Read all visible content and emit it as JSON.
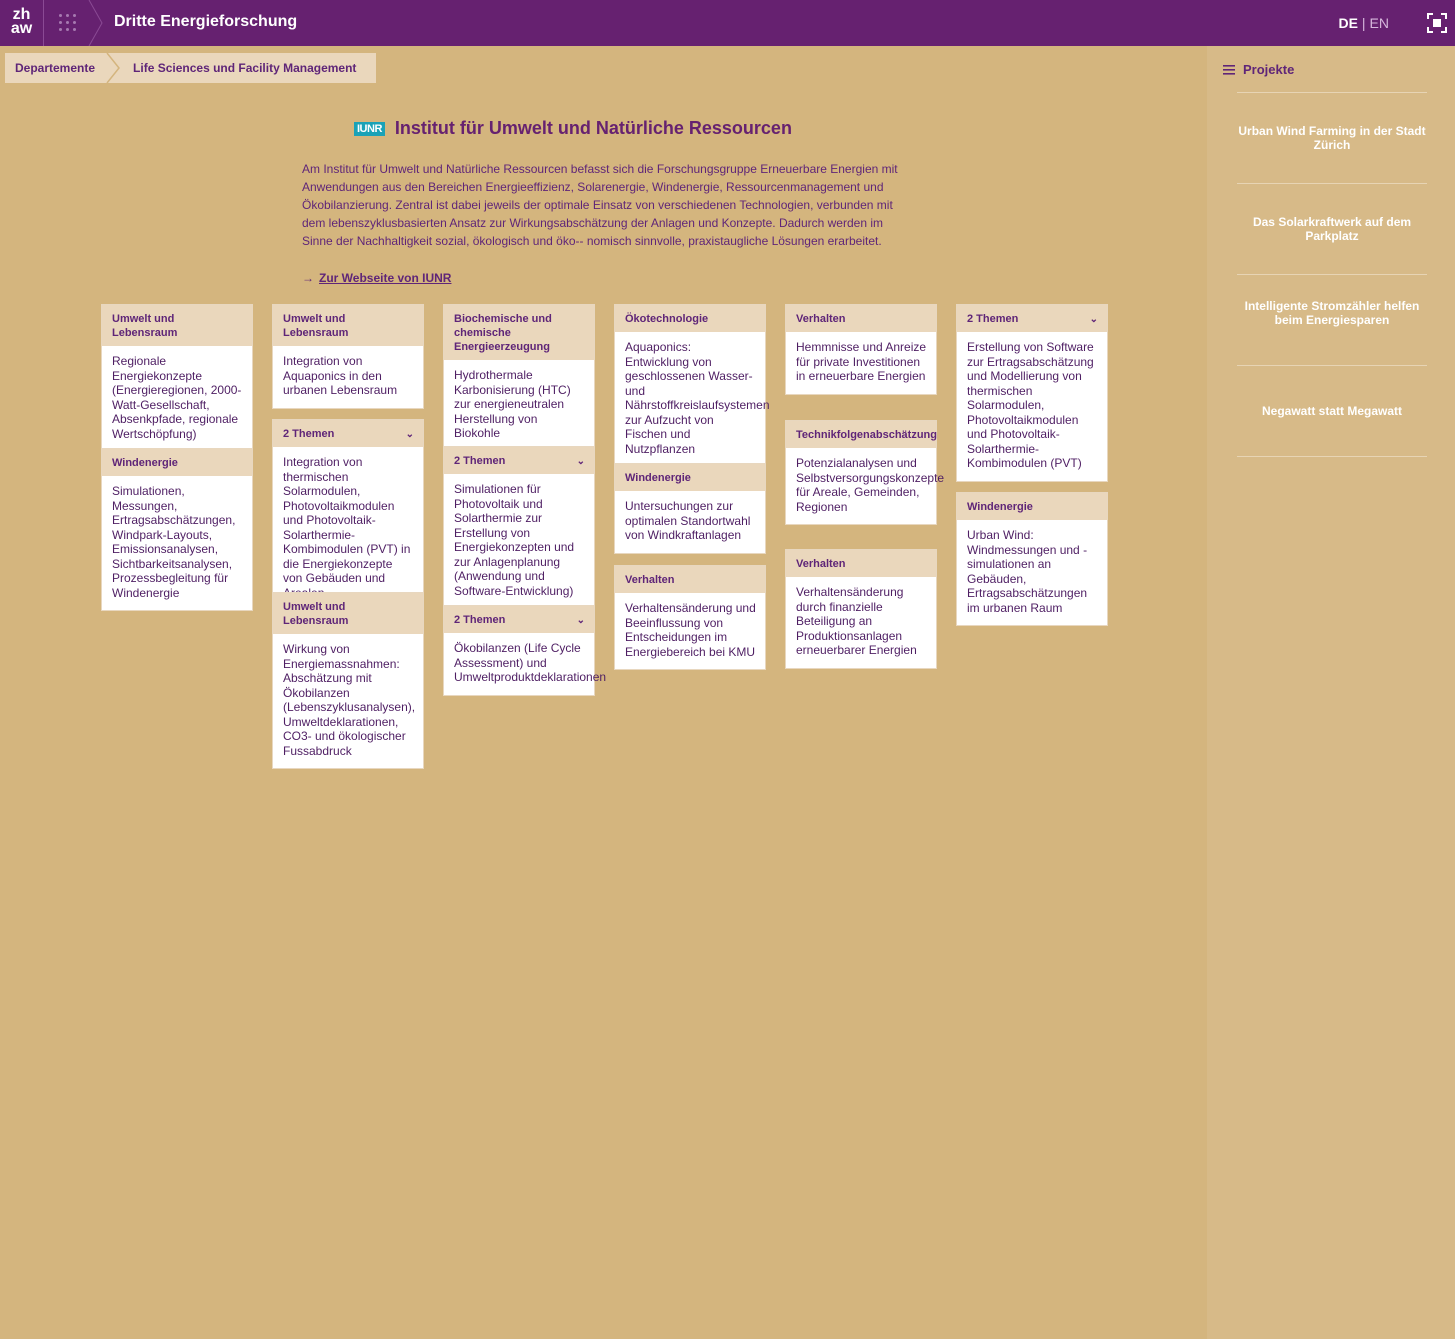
{
  "topbar": {
    "logo_line1": "zh",
    "logo_line2": "aw",
    "title": "Dritte Energieforschung",
    "lang_de": "DE",
    "lang_sep": "|",
    "lang_en": "EN"
  },
  "breadcrumb": {
    "items": [
      "Departemente",
      "Life Sciences und Facility Management"
    ]
  },
  "institute": {
    "badge": "IUNR",
    "title": "Institut für Umwelt und Natürliche Ressourcen",
    "description": "Am Institut für Umwelt und Natürliche Ressourcen befasst sich die Forschungsgruppe Erneuerbare Energien mit Anwendungen aus den Bereichen Energieeffizienz, Solarenergie, Windenergie, Ressourcenmanagement und Ökobilanzierung. Zentral ist dabei jeweils der optimale Einsatz von verschiedenen Technologien, verbunden mit dem lebenszyklusbasierten Ansatz zur Wirkungsabschätzung der Anlagen und Konzepte. Dadurch werden im Sinne der Nachhaltigkeit sozial, ökologisch und öko-- nomisch sinnvolle, praxistaugliche Lösungen erarbeitet.",
    "link_arrow": "→",
    "link": "Zur Webseite von IUNR"
  },
  "cards": [
    {
      "head": "Umwelt und Lebensraum",
      "body": "Regionale Energiekonzepte (Energieregionen, 2000-Watt-Gesellschaft, Absenkpfade, regionale Wertschöpfung)"
    },
    {
      "head": "Windenergie",
      "body": "Simulationen, Messungen, Ertragsabschätzungen, Windpark-Layouts, Emissionsanalysen, Sichtbarkeitsanalysen, Prozessbegleitung für Windenergie"
    },
    {
      "head": "Umwelt und Lebensraum",
      "body": "Integration von Aquaponics in den urbanen Lebensraum"
    },
    {
      "head": "2 Themen",
      "body": "Integration von thermischen Solarmodulen, Photovoltaikmodulen und Photovoltaik-Solarthermie-Kombimodulen (PVT) in die Energiekonzepte von Gebäuden und Arealen"
    },
    {
      "head": "Umwelt und Lebensraum",
      "body": "Wirkung von Energiemassnahmen: Abschätzung mit Ökobilanzen (Lebenszyklusanalysen), Umweltdeklarationen, CO3- und ökologischer Fussabdruck"
    },
    {
      "head": "Biochemische und chemische Energieerzeugung",
      "body": "Hydrothermale Karbonisierung (HTC) zur energieneutralen Herstellung von Biokohle"
    },
    {
      "head": "2 Themen",
      "body": "Simulationen für Photovoltaik und Solarthermie zur Erstellung von Energiekonzepten und zur Anlagenplanung (Anwendung und Software-Entwicklung)"
    },
    {
      "head": "2 Themen",
      "body": "Ökobilanzen (Life Cycle Assessment) und Umweltproduktdeklarationen"
    },
    {
      "head": "Ökotechnologie",
      "body": "Aquaponics: Entwicklung von geschlossenen Wasser- und Nährstoffkreislaufsystemen zur Aufzucht von Fischen und Nutzpflanzen"
    },
    {
      "head": "Windenergie",
      "body": "Untersuchungen zur optimalen Standortwahl von Windkraftanlagen"
    },
    {
      "head": "Verhalten",
      "body": "Verhaltensänderung und Beeinflussung von Entscheidungen im Energiebereich bei KMU"
    },
    {
      "head": "Verhalten",
      "body": "Hemmnisse und Anreize für private Investitionen in erneuerbare Energien"
    },
    {
      "head": "Technikfolgenabschätzung",
      "body": "Potenzialanalysen und Selbstversorgungskonzepte für Areale, Gemeinden, Regionen"
    },
    {
      "head": "Verhalten",
      "body": "Verhaltensänderung durch finanzielle Beteiligung an Produktionsanlagen erneuerbarer Energien"
    },
    {
      "head": "2 Themen",
      "body": "Erstellung von Software zur Ertragsabschätzung und Modellierung von thermischen Solarmodulen, Photovoltaikmodulen und Photovoltaik-Solarthermie-Kombimodulen (PVT)"
    },
    {
      "head": "Windenergie",
      "body": "Urban Wind: Windmessungen und -simulationen an Gebäuden, Ertragsabschätzungen im urbanen Raum"
    }
  ],
  "sidebar": {
    "title": "Projekte",
    "items": [
      "Urban Wind Farming in der Stadt Zürich",
      "Das Solarkraftwerk auf dem Parkplatz",
      "Intelligente Stromzähler helfen beim Energiesparen",
      "Negawatt statt Megawatt"
    ]
  },
  "colors": {
    "topbar": "#662170",
    "background": "#d4b57e",
    "card_head": "#ead7bc",
    "badge": "#1aa2b7"
  }
}
